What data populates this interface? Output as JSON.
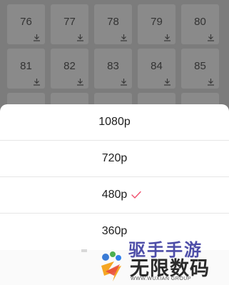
{
  "episodes": {
    "row1": [
      "76",
      "77",
      "78",
      "79",
      "80"
    ],
    "row2": [
      "81",
      "82",
      "83",
      "84",
      "85"
    ]
  },
  "resolution_sheet": {
    "options": [
      "1080p",
      "720p",
      "480p",
      "360p"
    ],
    "selected": "480p",
    "accent_color": "#f0506e"
  },
  "watermark": {
    "top_text": "驱手手游",
    "main_text": "无限数码",
    "sub_text": "WWW.WUXIAN GROUP"
  }
}
